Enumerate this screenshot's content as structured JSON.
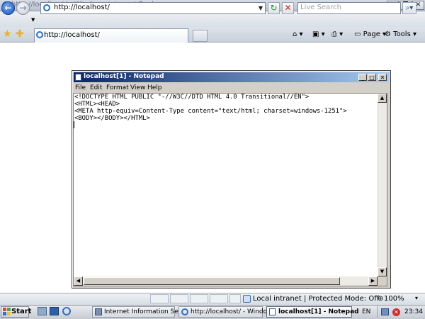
{
  "browser": {
    "window_title": "http://localhost/ - Windows Internet Explorer",
    "address": "http://localhost/",
    "search_placeholder": "Live Search",
    "tab_title": "http://localhost/",
    "tools": {
      "page": "Page",
      "tools": "Tools"
    },
    "status": {
      "zone": "Local intranet | Protected Mode: Off",
      "zoom": "100%"
    }
  },
  "notepad": {
    "title": "localhost[1] - Notepad",
    "menu": [
      "File",
      "Edit",
      "Format",
      "View",
      "Help"
    ],
    "content": "<!DOCTYPE HTML PUBLIC \"-//W3C//DTD HTML 4.0 Transitional//EN\">\n<HTML><HEAD>\n<META http-equiv=Content-Type content=\"text/html; charset=windows-1251\">\n<BODY></BODY></HTML>"
  },
  "taskbar": {
    "start": "Start",
    "tasks": [
      "Internet Information Ser...",
      "http://localhost/ - Windo...",
      "localhost[1] - Notepad"
    ],
    "language": "EN",
    "clock": "23:34"
  }
}
